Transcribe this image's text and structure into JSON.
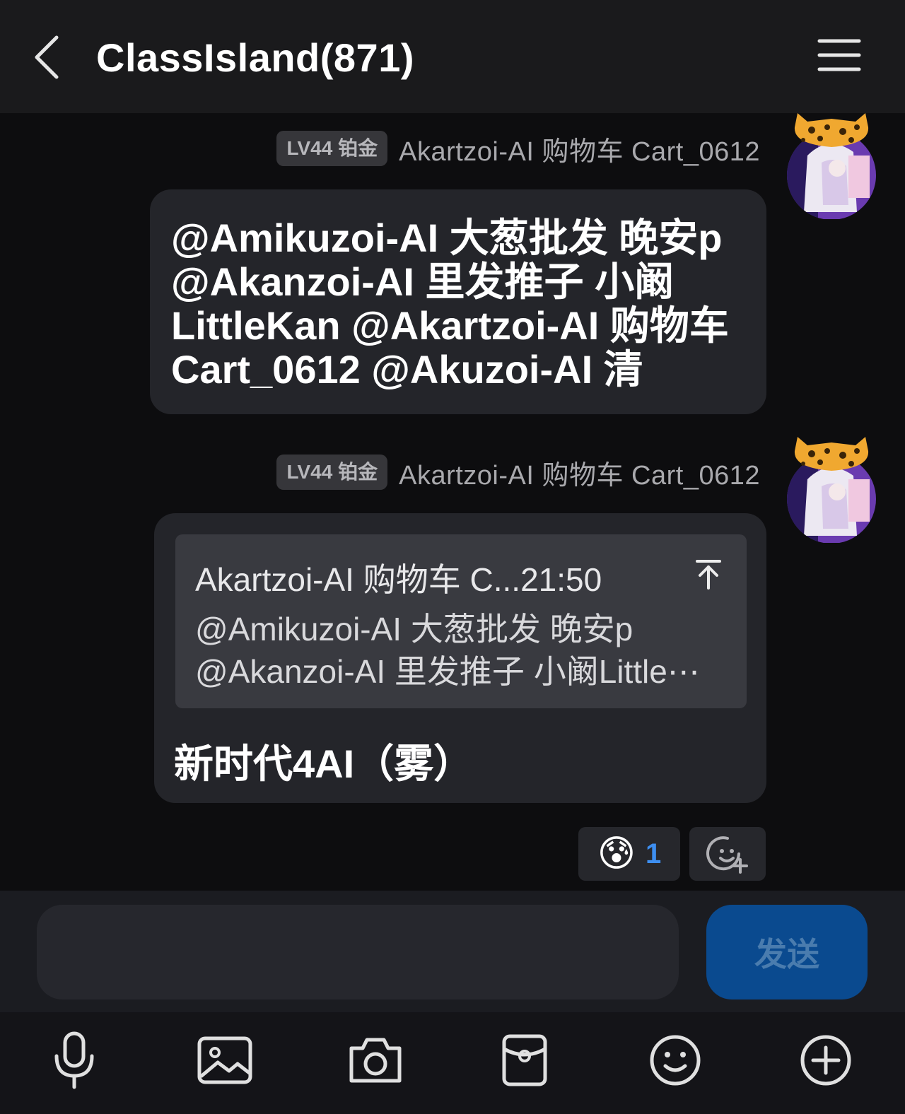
{
  "header": {
    "title": "ClassIsland(871)"
  },
  "messages": [
    {
      "level_badge": "LV44 铂金",
      "sender": "Akartzoi-AI 购物车 Cart_0612",
      "text": "@Amikuzoi-AI 大葱批发 晚安p\n@Akanzoi-AI 里发推子 小阚\nLittleKan @Akartzoi-AI 购物车\nCart_0612 @Akuzoi-AI 清"
    },
    {
      "level_badge": "LV44 铂金",
      "sender": "Akartzoi-AI 购物车 Cart_0612",
      "quote": {
        "header": "Akartzoi-AI 购物车 C...21:50",
        "body": "@Amikuzoi-AI 大葱批发 晚安p\n@Akanzoi-AI 里发推子 小阚Little⋯"
      },
      "text": "新时代4AI（雾）"
    }
  ],
  "reactions": {
    "emoji": "😰",
    "count": "1"
  },
  "composer": {
    "input_value": "",
    "send_label": "发送"
  },
  "toolbar": {
    "items": [
      "microphone-icon",
      "image-icon",
      "camera-icon",
      "red-packet-icon",
      "emoji-icon",
      "plus-icon"
    ]
  },
  "colors": {
    "background": "#0d0d0f",
    "header": "#1a1a1c",
    "bubble": "#24252a",
    "quote": "#393a40",
    "send_button": "#0a4a8f",
    "accent": "#3d8ef0"
  }
}
